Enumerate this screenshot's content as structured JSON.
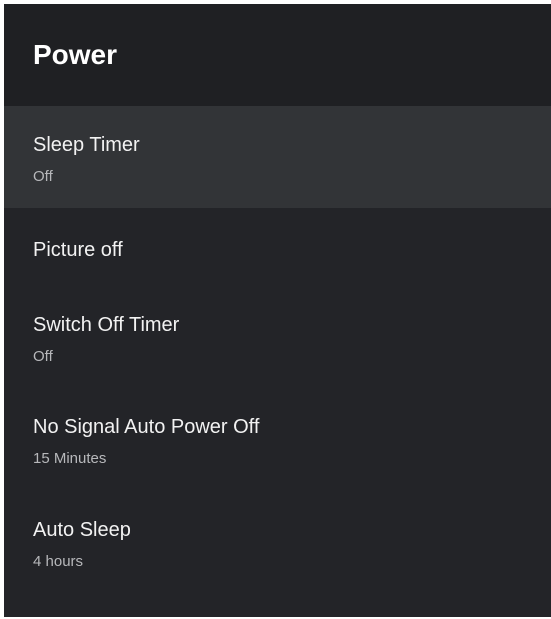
{
  "header": {
    "title": "Power"
  },
  "items": [
    {
      "title": "Sleep Timer",
      "value": "Off",
      "focused": true
    },
    {
      "title": "Picture off",
      "value": "",
      "focused": false
    },
    {
      "title": "Switch Off Timer",
      "value": "Off",
      "focused": false
    },
    {
      "title": "No Signal Auto Power Off",
      "value": "15 Minutes",
      "focused": false
    },
    {
      "title": "Auto Sleep",
      "value": "4 hours",
      "focused": false
    }
  ],
  "colors": {
    "panel_background": "#232428",
    "header_background": "#1f2023",
    "focused_background": "#323437",
    "title_text": "#f2f2f2",
    "value_text": "#b7b8bb"
  }
}
